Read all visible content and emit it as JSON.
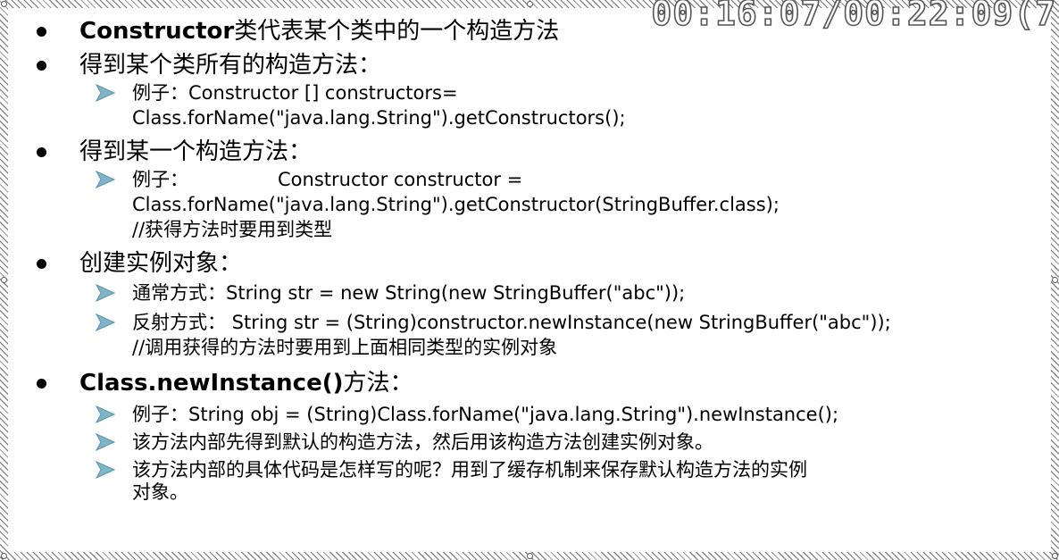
{
  "timer": {
    "text": "00:16:07/00:22:09(7"
  },
  "bullets": [
    {
      "bold": "Constructor",
      "rest": "类代表某个类中的一个构造方法"
    },
    {
      "text": "得到某个类所有的构造方法：",
      "sub": [
        {
          "label": "例子：",
          "code": "Constructor [] constructors=",
          "lines": [
            "Class.forName(\"java.lang.String\").getConstructors();"
          ]
        }
      ]
    },
    {
      "text": "得到某一个构造方法：",
      "sub": [
        {
          "label": "例子：",
          "code": "Constructor constructor =",
          "lines": [
            "Class.forName(\"java.lang.String\").getConstructor(StringBuffer.class);",
            "//获得方法时要用到类型"
          ]
        }
      ]
    },
    {
      "text": "创建实例对象：",
      "sub": [
        {
          "label": "通常方式：",
          "code": "String str = new String(new StringBuffer(\"abc\"));"
        },
        {
          "label": "反射方式：",
          "code": " String str = (String)constructor.newInstance(new StringBuffer(\"abc\"));",
          "lines": [
            "//调用获得的方法时要用到上面相同类型的实例对象"
          ]
        }
      ]
    },
    {
      "bold": "Class.newInstance()",
      "rest": "方法：",
      "sub": [
        {
          "label": "例子：",
          "code": "String obj = (String)Class.forName(\"java.lang.String\").newInstance();"
        },
        {
          "text": "该方法内部先得到默认的构造方法，然后用该构造方法创建实例对象。"
        },
        {
          "text": "该方法内部的具体代码是怎样写的呢？用到了缓存机制来保存默认构造方法的实例",
          "lines": [
            "对象。"
          ]
        }
      ]
    }
  ],
  "colors": {
    "arrow": "#7fb4c9",
    "bullet": "#000000",
    "border": "#6e6e6e"
  }
}
